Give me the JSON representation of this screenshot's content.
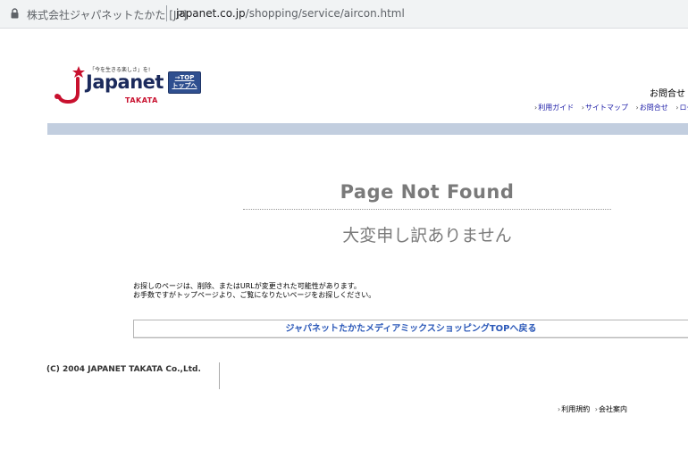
{
  "browser": {
    "site_name": "株式会社ジャパネットたかた [JP]",
    "url_domain": "japanet.co.jp",
    "url_path": "/shopping/service/aircon.html"
  },
  "header": {
    "logo_tagline": "「今を生きる楽しさ」を!",
    "logo_word": "Japanet",
    "logo_sub": "TAKATA",
    "top_badge_line1": "→TOP",
    "top_badge_line2": "トップへ",
    "contact_heading": "お問合せ",
    "nav": [
      "利用ガイド",
      "サイトマップ",
      "お問合せ",
      "ログ"
    ]
  },
  "main": {
    "title": "Page Not Found",
    "subtitle": "大変申し訳ありません",
    "message_line1": "お探しのページは、削除、またはURLが変更された可能性があります。",
    "message_line2": "お手数ですがトップページより、ご覧になりたいページをお探しください。",
    "back_button": "ジャパネットたかたメディアミックスショッピングTOPへ戻る"
  },
  "footer": {
    "copyright": "(C) 2004 JAPANET TAKATA Co.,Ltd.",
    "links": [
      "利用規約",
      "会社案内"
    ]
  },
  "colors": {
    "brand_red": "#c8102e",
    "brand_navy": "#1b2a5c",
    "header_band": "#c2cedf",
    "link_blue": "#1a1aa6"
  }
}
